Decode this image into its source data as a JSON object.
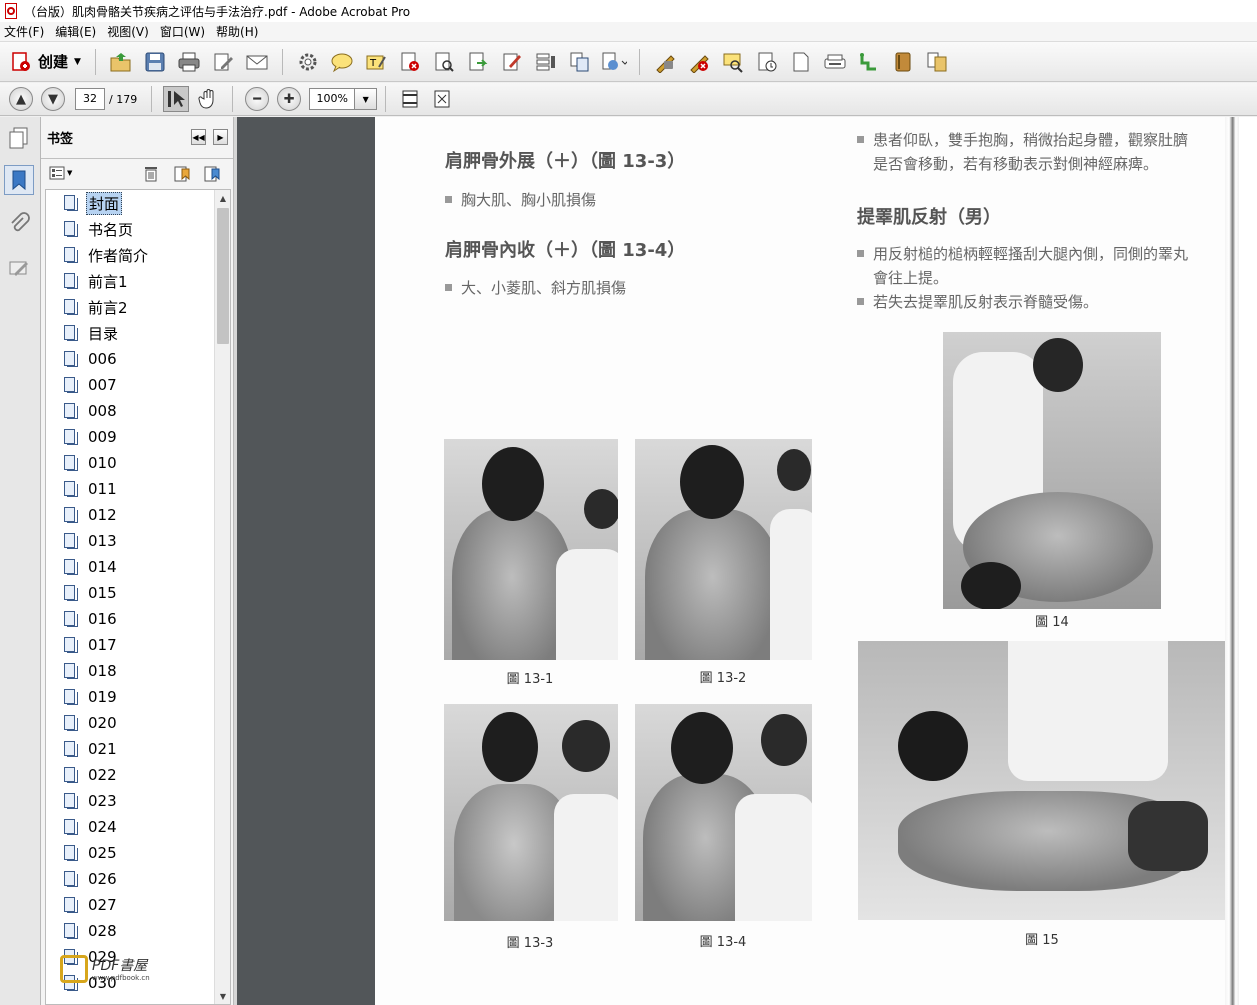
{
  "window": {
    "title": "（台版）肌肉骨骼关节疾病之评估与手法治疗.pdf - Adobe Acrobat Pro"
  },
  "menu": [
    "文件(F)",
    "编辑(E)",
    "视图(V)",
    "窗口(W)",
    "帮助(H)"
  ],
  "toolbar": {
    "create_label": "创建"
  },
  "navigation": {
    "current_page": "32",
    "total_pages": "/ 179",
    "zoom": "100%"
  },
  "bookmarks_panel": {
    "title": "书签",
    "items": [
      "封面",
      "书名页",
      "作者简介",
      "前言1",
      "前言2",
      "目录",
      "006",
      "007",
      "008",
      "009",
      "010",
      "011",
      "012",
      "013",
      "014",
      "015",
      "016",
      "017",
      "018",
      "019",
      "020",
      "021",
      "022",
      "023",
      "024",
      "025",
      "026",
      "027",
      "028",
      "029",
      "030"
    ],
    "selected_index": 0
  },
  "document": {
    "left_column": {
      "sections": [
        {
          "title": "肩胛骨外展（＋）（圖 13-3）",
          "bullets": [
            "胸大肌、胸小肌損傷"
          ]
        },
        {
          "title": "肩胛骨內收（＋）（圖 13-4）",
          "bullets": [
            "大、小菱肌、斜方肌損傷"
          ]
        }
      ],
      "captions": [
        "圖 13-1",
        "圖 13-2",
        "圖 13-3",
        "圖 13-4"
      ]
    },
    "right_column": {
      "intro_line1": "患者仰臥，雙手抱胸，稍微抬起身體，觀察肚臍",
      "intro_line2": "是否會移動，若有移動表示對側神經麻痺。",
      "section_title": "提睪肌反射（男）",
      "bullet1_line1": "用反射槌的槌柄輕輕搔刮大腿內側，同側的睪丸",
      "bullet1_line2": "會往上提。",
      "bullet2": "若失去提睪肌反射表示脊髓受傷。",
      "captions": [
        "圖 14",
        "圖 15"
      ]
    }
  },
  "watermark": {
    "text": "PDF書屋",
    "url": "www.pdfbook.cn"
  }
}
